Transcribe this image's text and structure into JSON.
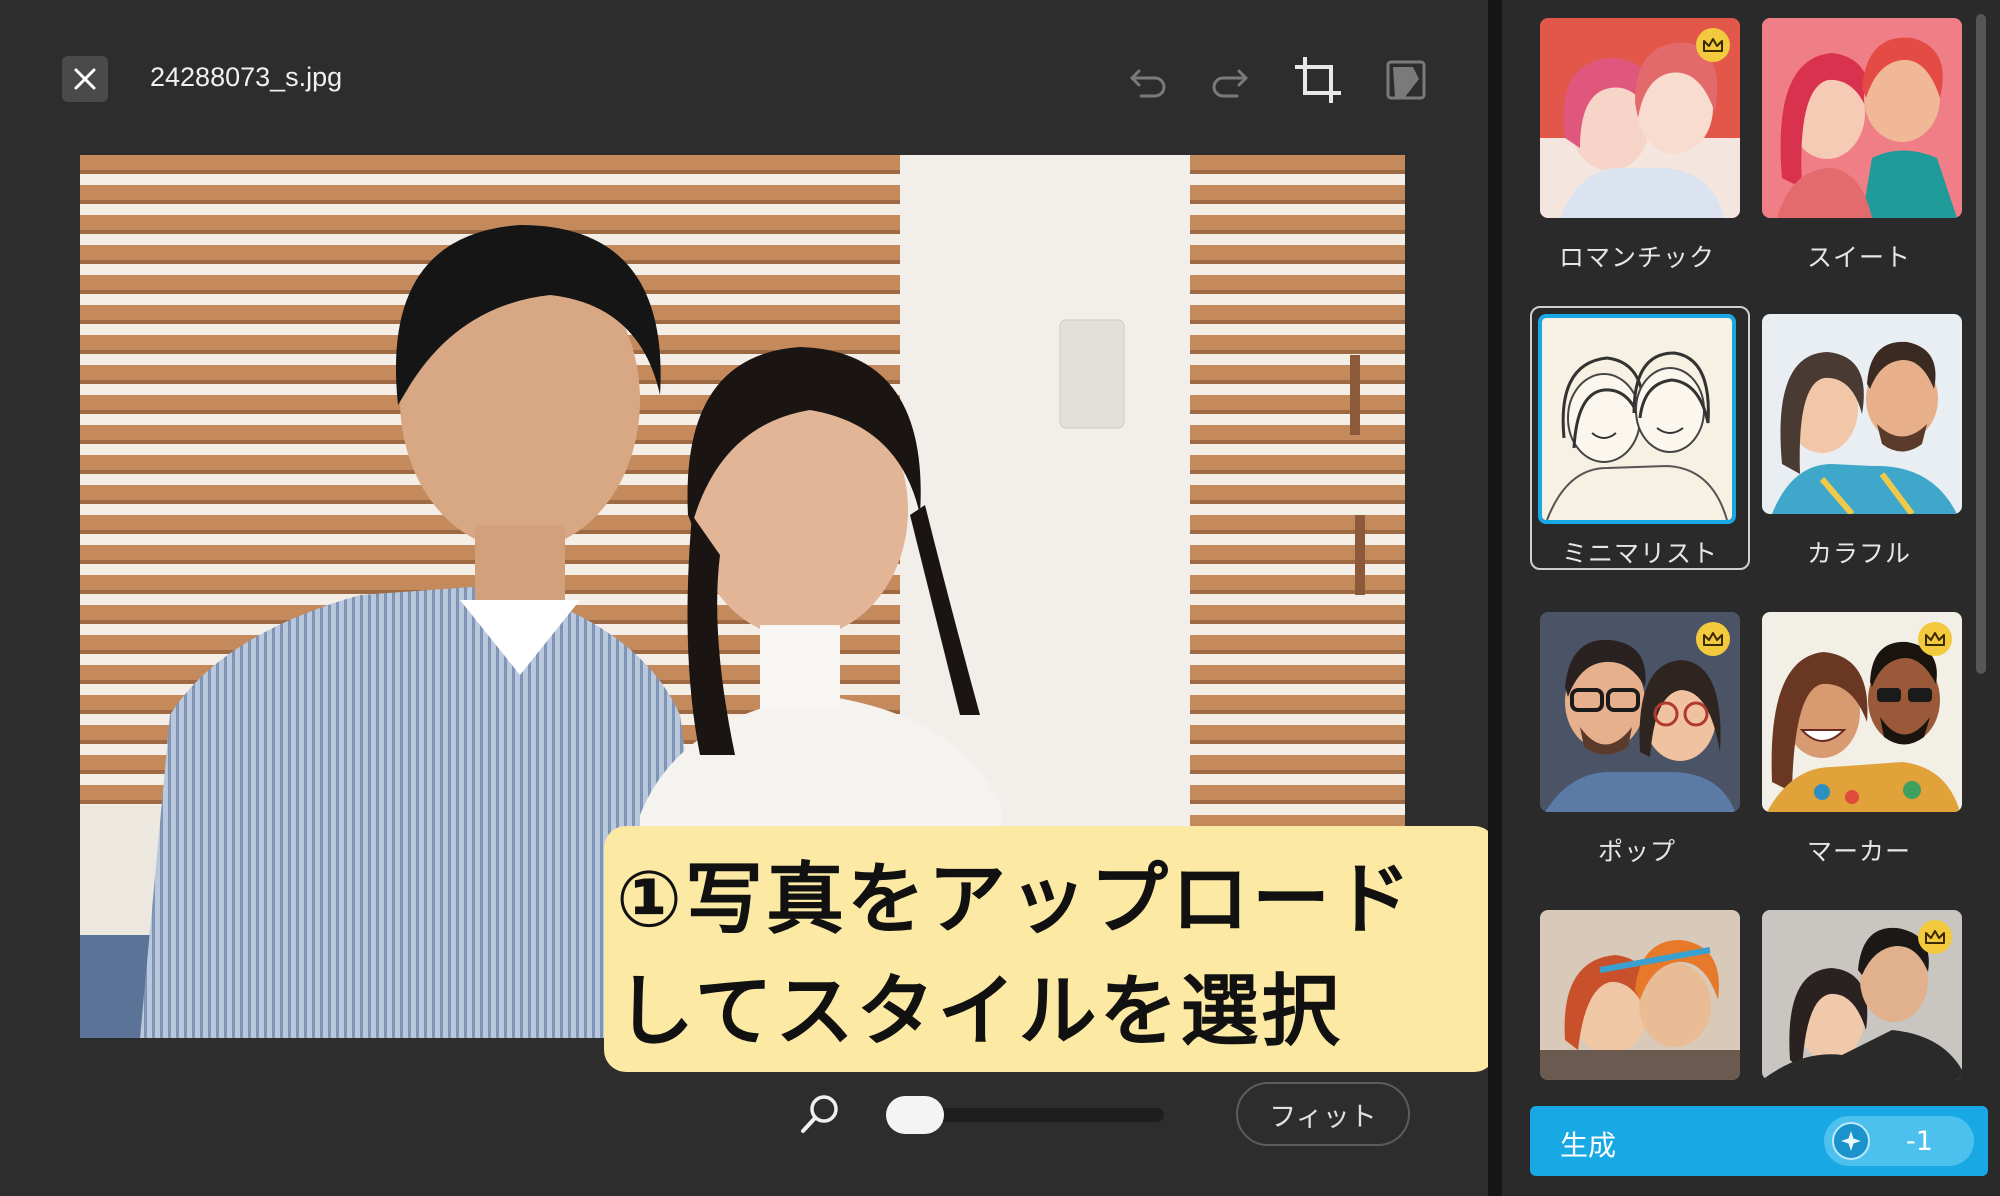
{
  "header": {
    "filename": "24288073_s.jpg",
    "tools": [
      "undo-icon",
      "redo-icon",
      "crop-icon",
      "eraser-icon"
    ]
  },
  "caption": {
    "line1": "①写真をアップロード",
    "line2": "してスタイルを選択"
  },
  "zoom": {
    "level": 0,
    "fit_label": "フィット"
  },
  "styles": [
    {
      "label": "ロマンチック",
      "premium": true,
      "selected": false
    },
    {
      "label": "スイート",
      "premium": false,
      "selected": false
    },
    {
      "label": "ミニマリスト",
      "premium": false,
      "selected": true
    },
    {
      "label": "カラフル",
      "premium": false,
      "selected": false
    },
    {
      "label": "ポップ",
      "premium": true,
      "selected": false
    },
    {
      "label": "マーカー",
      "premium": true,
      "selected": false
    },
    {
      "label": "",
      "premium": false,
      "selected": false
    },
    {
      "label": "",
      "premium": true,
      "selected": false
    }
  ],
  "generate": {
    "label": "生成",
    "credit": "-1"
  },
  "colors": {
    "accent": "#18a9e5",
    "caption_bg": "#fbe9a4",
    "crown": "#f3c93d"
  }
}
